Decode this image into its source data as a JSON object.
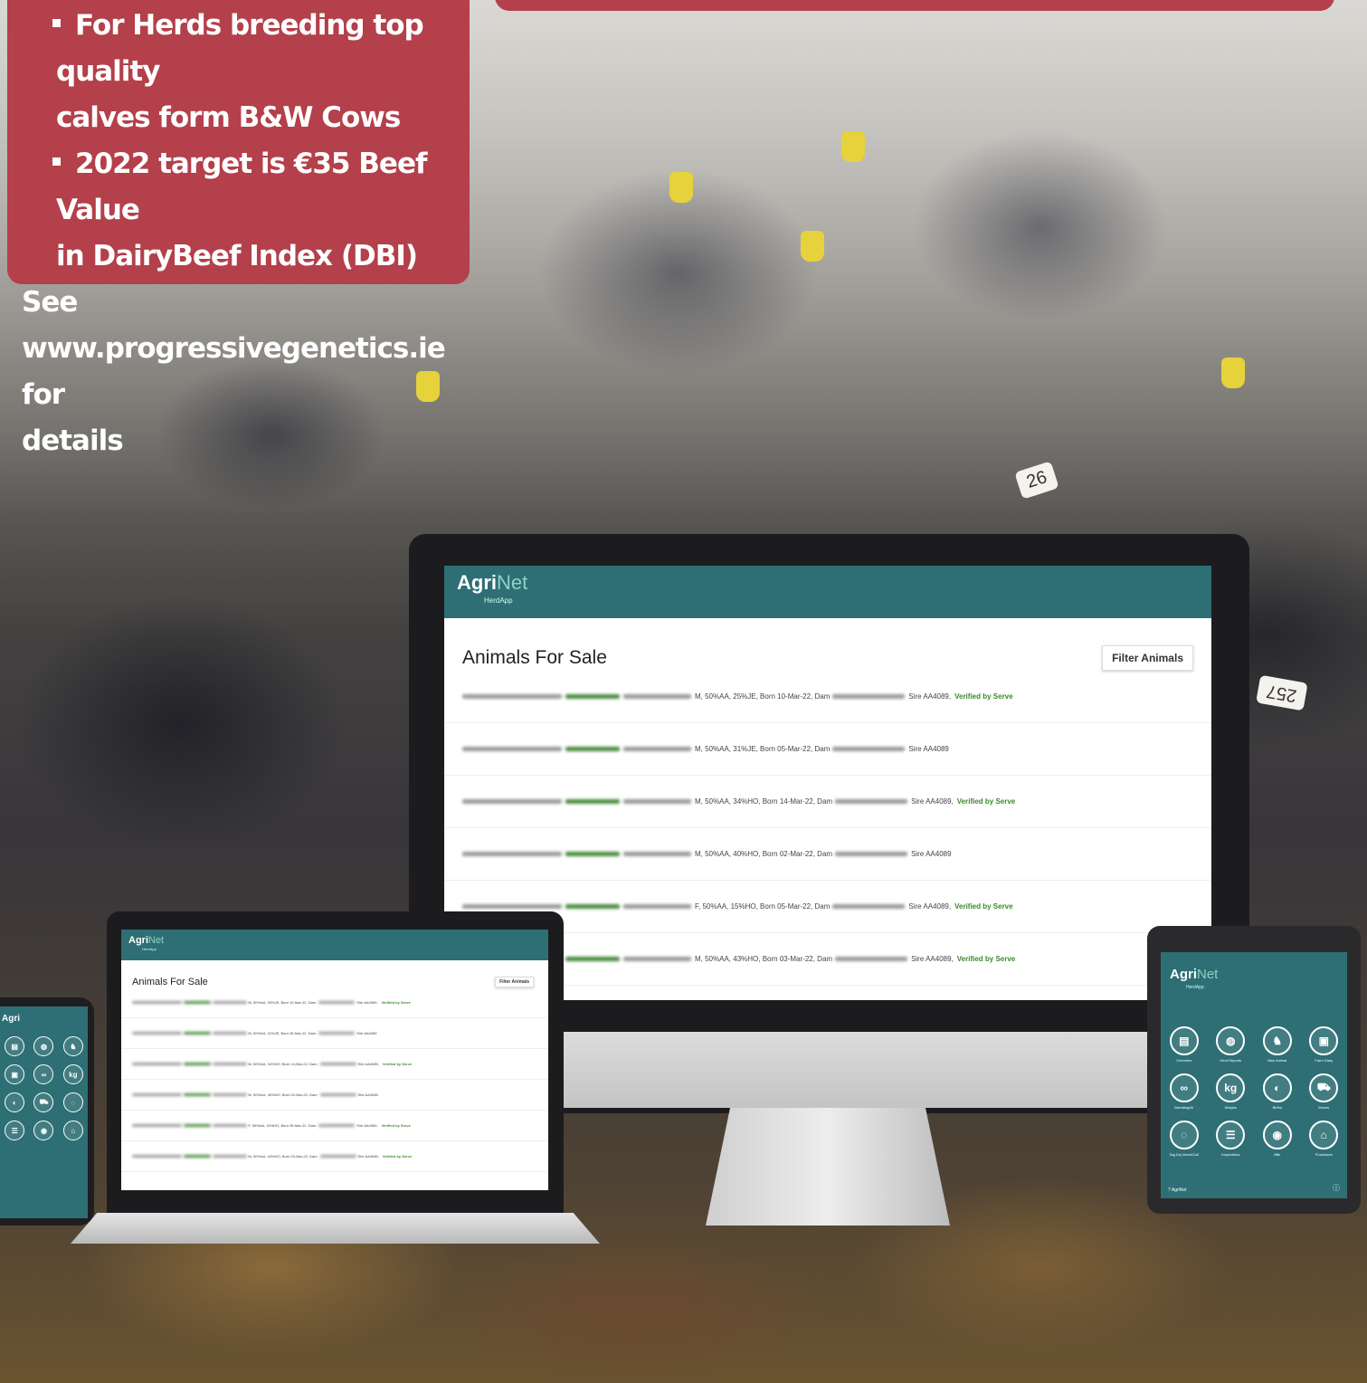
{
  "info_box": {
    "bullet_1": "For Herds breeding top quality",
    "bullet_1_cont": "calves form B&W Cows",
    "bullet_2": "2022 target is €35 Beef Value",
    "bullet_2_cont": "in DairyBeef Index (DBI)",
    "see_line": "See www.progressivegenetics.ie for",
    "see_line_cont": "details"
  },
  "photo_tags": [
    "26",
    "257",
    "257",
    "26"
  ],
  "monitor": {
    "logo": "Agri",
    "logo_net": "Net",
    "logo_sub": "HerdApp",
    "title": "Animals For Sale",
    "filter_button": "Filter Animals",
    "rows": [
      {
        "details": "M, 50%AA, 25%JE, Born 10-Mar-22, Dam",
        "sire": "Sire AA4089,",
        "verified": "Verified by Serve"
      },
      {
        "details": "M, 50%AA, 31%JE, Born 05-Mar-22, Dam",
        "sire": "Sire AA4089",
        "verified": ""
      },
      {
        "details": "M, 50%AA, 34%HO, Born 14-Mar-22, Dam",
        "sire": "Sire AA4089,",
        "verified": "Verified by Serve"
      },
      {
        "details": "M, 50%AA, 40%HO, Born 02-Mar-22, Dam",
        "sire": "Sire AA4089",
        "verified": ""
      },
      {
        "details": "F, 50%AA, 15%HO, Born 05-Mar-22, Dam",
        "sire": "Sire AA4089,",
        "verified": "Verified by Serve"
      },
      {
        "details": "M, 50%AA, 43%HO, Born 03-Mar-22, Dam",
        "sire": "Sire AA4089,",
        "verified": "Verified by Serve"
      }
    ]
  },
  "laptop": {
    "title": "Animals For Sale",
    "filter_button": "Filter Animals"
  },
  "tablet": {
    "logo": "Agri",
    "logo_net": "Net",
    "logo_sub": "HerdApp",
    "tiles": [
      "Overview",
      "Herd Reports",
      "New Animal",
      "Farm Diary",
      "Breeding/AI",
      "Weighs",
      "Births",
      "Moves",
      "Tag Dry Move/Cull",
      "Inspections",
      "Milk",
      "Purchases"
    ],
    "footer": "? AgriNet"
  },
  "phone": {
    "logo": "Agri"
  },
  "colors": {
    "banner": "#b3404a",
    "app_teal": "#2d6f74",
    "verified_green": "#3a8a2a"
  }
}
